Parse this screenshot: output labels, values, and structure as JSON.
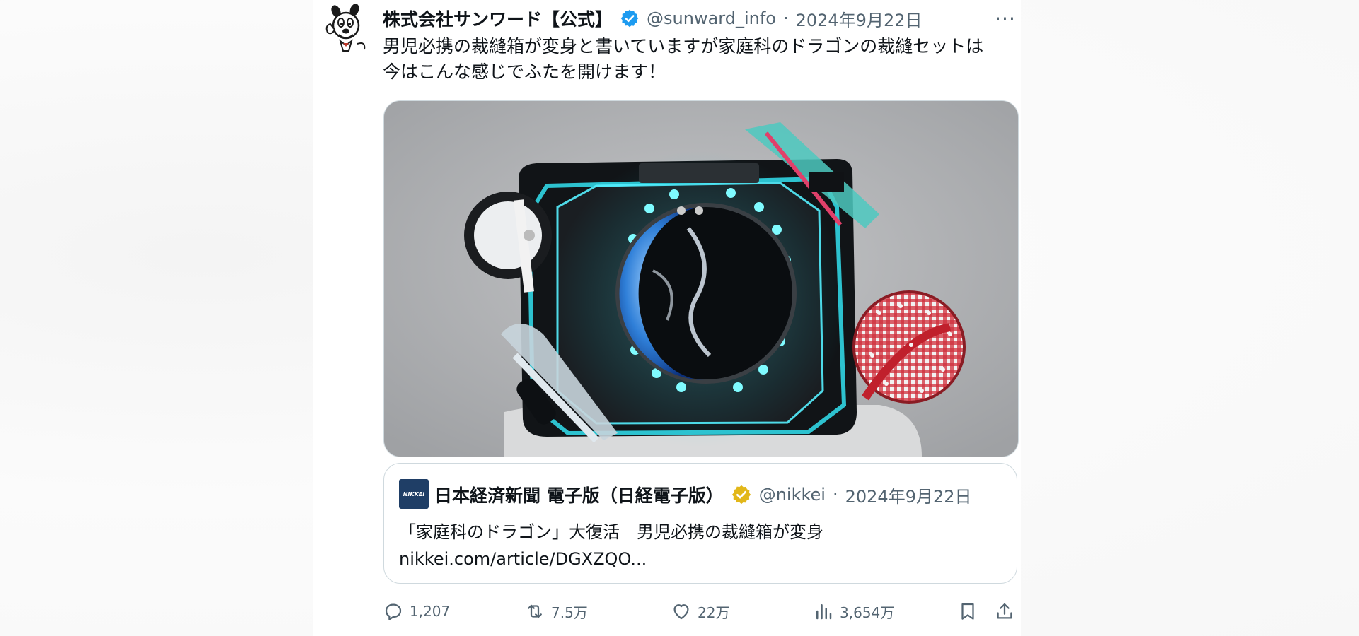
{
  "tweet": {
    "author_name": "株式会社サンワード【公式】",
    "handle": "@sunward_info",
    "dot": "·",
    "date": "2024年9月22日",
    "more": "···",
    "text_line1": "男児必携の裁縫箱が変身と書いていますが家庭科のドラゴンの裁縫セットは",
    "text_line2": "今はこんな感じでふたを開けます！"
  },
  "quote": {
    "logo_text": "NIKKEI",
    "author_name": "日本経済新聞 電子版（日経電子版）",
    "handle": "@nikkei",
    "dot": "·",
    "date": "2024年9月22日",
    "text_line1": "「家庭科のドラゴン」大復活　男児必携の裁縫箱が変身",
    "text_line2": "nikkei.com/article/DGXZQO..."
  },
  "actions": {
    "reply_count": "1,207",
    "retweet_count": "7.5万",
    "like_count": "22万",
    "views_count": "3,654万"
  },
  "icons": {
    "verified_blue": "verified-badge-icon",
    "verified_gold": "verified-org-badge-icon",
    "reply": "reply-icon",
    "retweet": "retweet-icon",
    "like": "heart-icon",
    "views": "views-chart-icon",
    "bookmark": "bookmark-icon",
    "share": "share-icon"
  },
  "colors": {
    "text_primary": "#0f1419",
    "text_secondary": "#536471",
    "verified_blue": "#1d9bf0",
    "verified_gold": "#e2b719",
    "border": "#cfd9de"
  }
}
